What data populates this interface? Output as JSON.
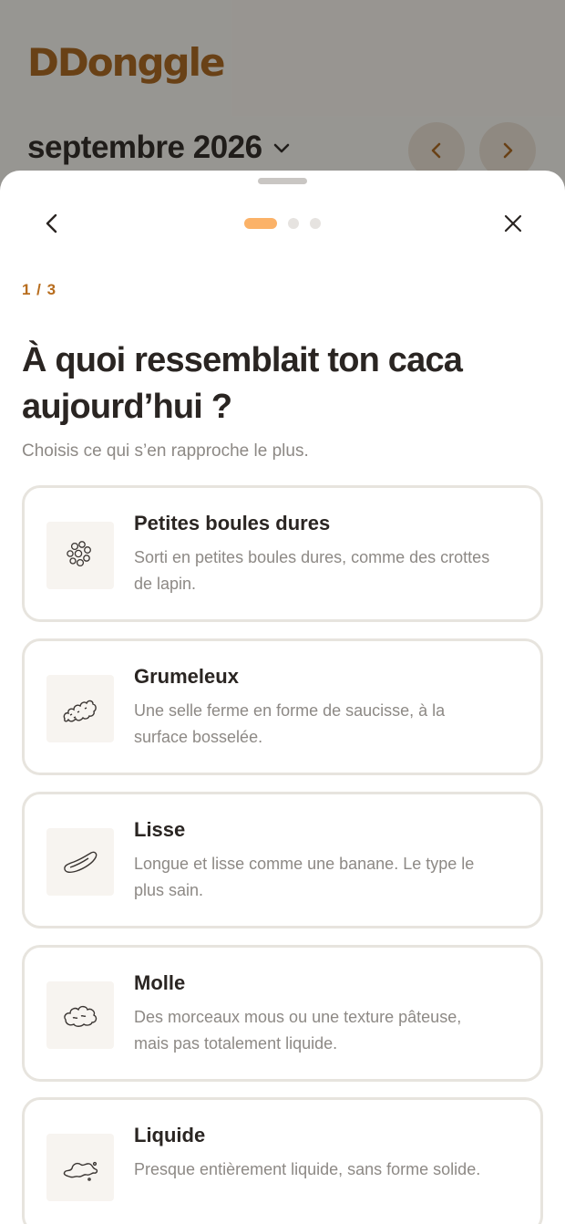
{
  "app": {
    "logo": "DDonggle"
  },
  "header": {
    "month": "septembre 2026"
  },
  "sheet": {
    "step": "1 / 3",
    "title": "À quoi ressemblait ton caca aujourd’hui ?",
    "subtitle": "Choisis ce qui s’en rapproche le plus.",
    "progress": {
      "current": 1,
      "total": 3
    }
  },
  "options": [
    {
      "title": "Petites boules dures",
      "description": "Sorti en petites boules dures, comme des crottes de lapin.",
      "icon": "hard-lumps-icon"
    },
    {
      "title": "Grumeleux",
      "description": "Une selle ferme en forme de saucisse, à la surface bosselée.",
      "icon": "lumpy-sausage-icon"
    },
    {
      "title": "Lisse",
      "description": "Longue et lisse comme une banane. Le type le plus sain.",
      "icon": "smooth-sausage-icon"
    },
    {
      "title": "Molle",
      "description": "Des morceaux mous ou une texture pâteuse, mais pas totalement liquide.",
      "icon": "soft-blob-icon"
    },
    {
      "title": "Liquide",
      "description": "Presque entièrement liquide, sans forme solide.",
      "icon": "liquid-splash-icon"
    }
  ],
  "colors": {
    "accent": "#b86d1e",
    "logo": "#a8621a",
    "progress_active": "#fbb268",
    "border": "#e7e4de"
  }
}
